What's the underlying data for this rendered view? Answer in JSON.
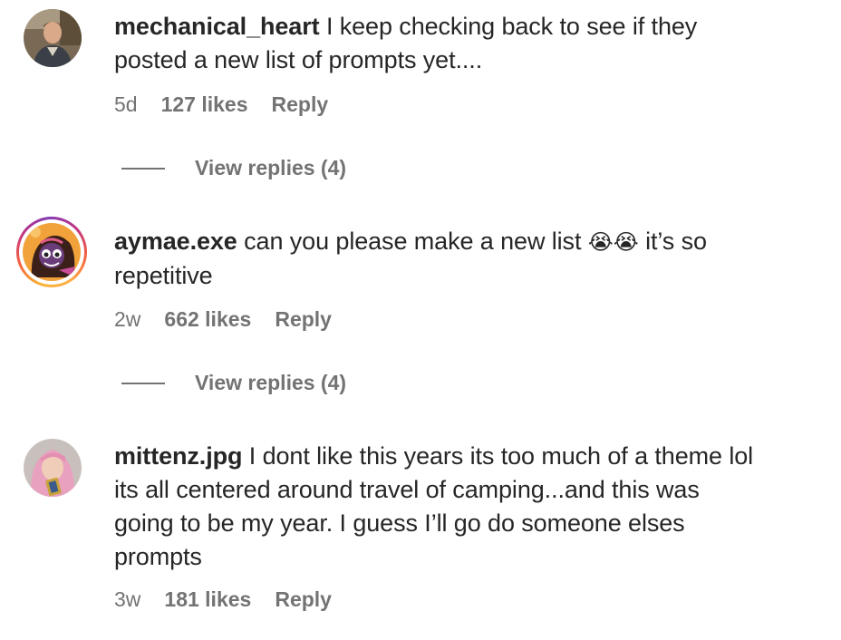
{
  "comments": [
    {
      "username": "mechanical_heart",
      "text_lines": [
        "I keep checking back to see if they",
        "posted a new list of prompts yet...."
      ],
      "time": "5d",
      "likes": "127 likes",
      "reply": "Reply",
      "view_replies": "View replies (4)",
      "avatar_icon": "person-photo"
    },
    {
      "username": "aymae.exe",
      "text_lines": [
        "can you please make a new list",
        "repetitive"
      ],
      "emoji": "😭😭",
      "text_after_emoji": "it’s so",
      "time": "2w",
      "likes": "662 likes",
      "reply": "Reply",
      "view_replies": "View replies (4)",
      "avatar_icon": "cartoon-character-with-story-ring"
    },
    {
      "username": "mittenz.jpg",
      "text_lines": [
        "I dont like this years its too much of a theme lol",
        "its all centered around travel of camping...and this was",
        "going to be my year. I guess I’ll go do someone elses",
        "prompts"
      ],
      "time": "3w",
      "likes": "181 likes",
      "reply": "Reply",
      "avatar_icon": "person-photo-pink-hair"
    }
  ],
  "colors": {
    "text": "#262626",
    "secondary": "#737373",
    "story_ring": [
      "#f9b233",
      "#f56040",
      "#c13584",
      "#833ab4"
    ]
  }
}
